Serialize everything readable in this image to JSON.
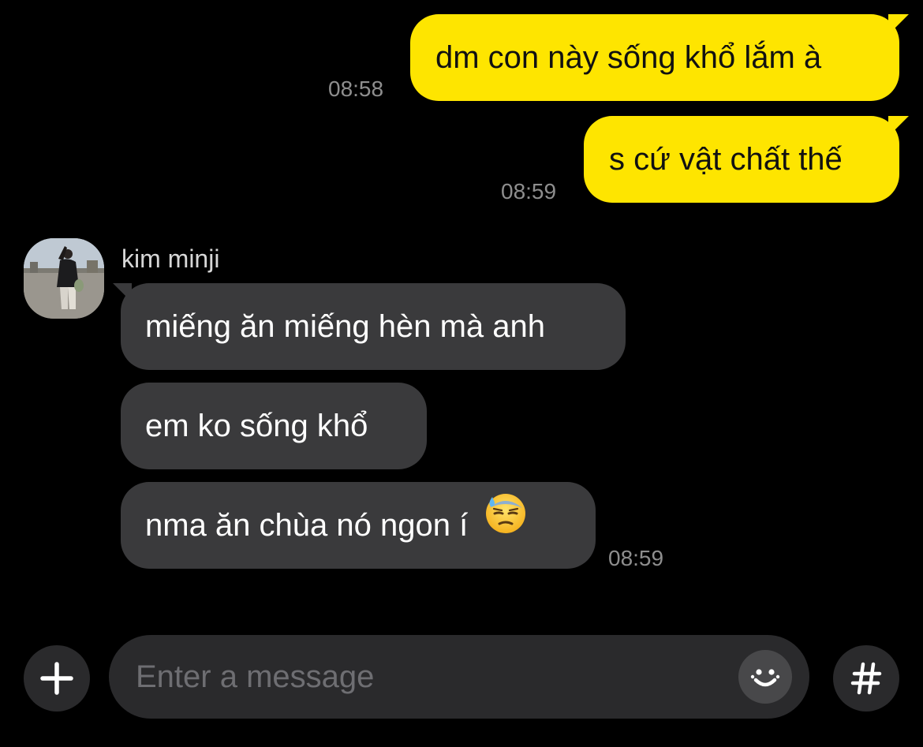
{
  "messages": {
    "outgoing": [
      {
        "text": "dm con này sống khổ lắm à",
        "time": "08:58"
      },
      {
        "text": "s cứ vật chất thế",
        "time": "08:59"
      }
    ],
    "incoming": {
      "sender": "kim minji",
      "items": [
        {
          "text": "miếng ăn miếng hèn mà anh"
        },
        {
          "text": "em ko sống khổ"
        },
        {
          "text": "nma ăn chùa nó ngon í",
          "emoji": "downcast-face-with-sweat"
        }
      ],
      "time": "08:59"
    }
  },
  "composer": {
    "placeholder": "Enter a message",
    "value": "",
    "add_icon": "plus-icon",
    "emoticon_icon": "smiley-icon",
    "hashtag_icon": "hash-icon"
  },
  "colors": {
    "background": "#000000",
    "outgoing_bubble": "#FEE500",
    "incoming_bubble": "#3A3A3C",
    "timestamp": "#8E8E8E"
  }
}
